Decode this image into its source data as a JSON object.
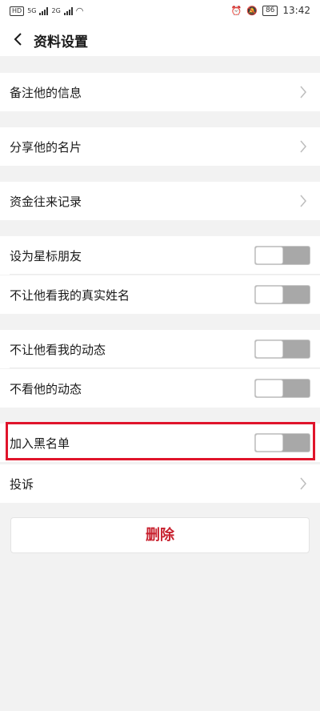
{
  "status_bar": {
    "hd": "HD",
    "sim1": "5G",
    "sim2": "2G",
    "battery": "86",
    "time": "13:42"
  },
  "header": {
    "title": "资料设置"
  },
  "rows": [
    {
      "label": "备注他的信息",
      "control": "chevron"
    },
    {
      "label": "分享他的名片",
      "control": "chevron"
    },
    {
      "label": "资金往来记录",
      "control": "chevron"
    },
    {
      "label": "设为星标朋友",
      "control": "toggle",
      "on": false
    },
    {
      "label": "不让他看我的真实姓名",
      "control": "toggle",
      "on": false
    },
    {
      "label": "不让他看我的动态",
      "control": "toggle",
      "on": false
    },
    {
      "label": "不看他的动态",
      "control": "toggle",
      "on": false
    },
    {
      "label": "加入黑名单",
      "control": "toggle",
      "on": false
    },
    {
      "label": "投诉",
      "control": "chevron"
    }
  ],
  "delete_button": {
    "label": "删除"
  },
  "colors": {
    "accent_red": "#c8222f",
    "highlight": "#e0142b"
  }
}
